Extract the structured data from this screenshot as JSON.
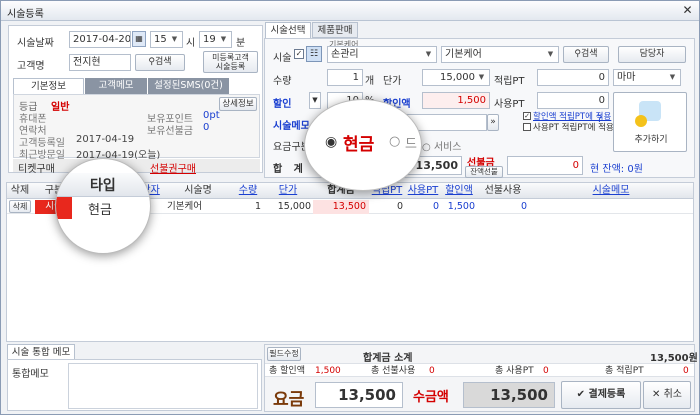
{
  "window": {
    "title": "시술등록",
    "close": "✕"
  },
  "left": {
    "date_label": "시술날짜",
    "date_value": "2017-04-20",
    "hour": "15",
    "hour_unit": "시",
    "minute": "19",
    "minute_unit": "분",
    "customer_label": "고객명",
    "customer_value": "전지현",
    "search_label": "검색",
    "unregistered_label": "미등록고객\n시술등록",
    "tabs": [
      "기본정보",
      "고객메모",
      "설정된SMS(0건)"
    ],
    "grade_label": "등급",
    "grade_value": "일반",
    "detail_btn": "상세정보",
    "mobile_label": "휴대폰",
    "points_label": "보유포인트",
    "points_value": "0pt",
    "contact_label": "연락처",
    "prepaid_label": "보유선불금",
    "prepaid_value": "0",
    "registered_label": "고객등록일",
    "registered_value": "2017-04-19",
    "lastvisit_label": "최근방문일",
    "lastvisit_value": "2017-04-19(오늘)",
    "ticket_label": "티켓구매",
    "prepaid_buy": "선불권구매"
  },
  "right": {
    "tabs": [
      "시술선택",
      "제품판매"
    ],
    "group_caption": "기본케어",
    "service_label": "시술",
    "service_value": "손관리",
    "service_sub": "기본케어",
    "search_label": "검색",
    "staff_btn": "담당자",
    "qty_label": "수량",
    "qty_value": "1",
    "qty_unit": "개",
    "price_label": "단가",
    "price_value": "15,000",
    "earn_label": "적립PT",
    "earn_value": "0",
    "staff_value": "마마",
    "discount_label": "할인",
    "discount_value": "10",
    "discount_unit": "%",
    "discount_amt_label": "할인액",
    "discount_amt_value": "1,500",
    "use_pt_label": "사용PT",
    "use_pt_value": "0",
    "memo_label": "시술메모",
    "memo_btn": "»",
    "chk1": "할인액 적립PT에 적용",
    "chk2": "사용PT 적립PT에 적용",
    "add_btn": "추가하기",
    "pay_type_label": "요금구분",
    "pay_cash": "현금",
    "pay_card": "카드",
    "pay_service": "서비스",
    "total_label": "합 계",
    "total_value": "13,500",
    "prepaid_label": "선불금",
    "prepaid_sub": "잔액선불",
    "prepaid_value": "0",
    "balance": "현 잔액: 0원"
  },
  "table": {
    "headers": [
      "삭제",
      "구분",
      "타입",
      "담당자",
      "시술명",
      "수량",
      "단가",
      "합계금",
      "적립PT",
      "사용PT",
      "할인액",
      "선불사용",
      "시술메모"
    ],
    "rows": [
      {
        "del": "삭제",
        "kind": "시술",
        "type": "현금",
        "staff": "마마",
        "name": "기본케어",
        "qty": "1",
        "price": "15,000",
        "total": "13,500",
        "earn": "0",
        "use": "0",
        "discount": "1,500",
        "prepaid": "0",
        "memo": ""
      }
    ]
  },
  "zoom": {
    "header": "타입",
    "value": "현금",
    "pay_cash": "현금",
    "pay_other": "드"
  },
  "bottom": {
    "memo_tab": "시술 통합 메모",
    "memo_label": "통합메모",
    "fix_btn": "필드수정",
    "sum_title": "합계금 소계",
    "sum_value": "13,500원",
    "sum_discount_label": "총 할인액",
    "sum_discount_value": "1,500",
    "sum_prepaid_label": "총 선불사용",
    "sum_prepaid_value": "0",
    "sum_use_label": "총 사용PT",
    "sum_use_value": "0",
    "sum_earn_label": "총 적립PT",
    "sum_earn_value": "0",
    "fee_label": "요금",
    "fee_value": "13,500",
    "cash_label": "수금액",
    "cash_value": "13,500",
    "confirm_btn": "결제등록",
    "cancel_btn": "취소"
  }
}
